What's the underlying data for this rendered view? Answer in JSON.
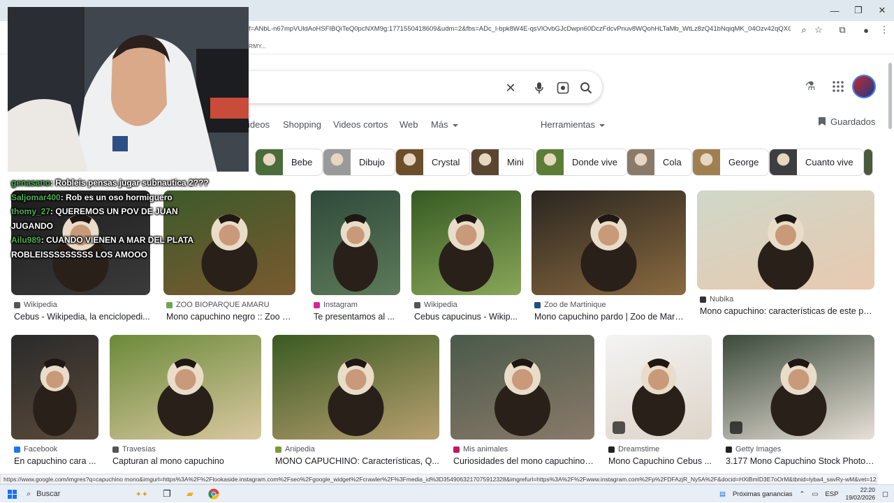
{
  "browser": {
    "url": "f=ANbL-n67mpVUldAoHSFIBQiTeQ0pcNXM9g:1771550418609&udm=2&fbs=ADc_l-bpk8W4E-qsVlOvbGJcDwpn60DczFdcvPnuv8WQohHLTaMb_WtLz8zQ41bNqiqMK_04Ozv42qQXGXRTV...",
    "bookmark_label": "RMY...",
    "status_url": "https://www.google.com/imgres?q=capuchino mono&imgurl=https%3A%2F%2Flookaside.instagram.com%2Fseo%2Fgoogle_widget%2Fcrawler%2F%3Fmedia_id%3D3549063217075912328&imgrefurl=https%3A%2F%2Fwww.instagram.com%2Fp%2FDFAzjR_Ny5A%2F&docid=HXiBmID3E7oOrM&tbnid=lyba4_savRy-wM&vet=12ahUKEwil_djM8-aSAxWS..."
  },
  "tabs": [
    {
      "label": "ideos"
    },
    {
      "label": "Shopping"
    },
    {
      "label": "Videos cortos"
    },
    {
      "label": "Web"
    },
    {
      "label": "Más"
    }
  ],
  "tools_label": "Herramientas",
  "saved_label": "Guardados",
  "chips": [
    {
      "label": "Bebe",
      "color": "#4a6b3a"
    },
    {
      "label": "Dibujo",
      "color": "#9a9a9a"
    },
    {
      "label": "Crystal",
      "color": "#6b4e2a"
    },
    {
      "label": "Mini",
      "color": "#5a4630"
    },
    {
      "label": "Donde vive",
      "color": "#5b7d35"
    },
    {
      "label": "Cola",
      "color": "#8a7a6a"
    },
    {
      "label": "George",
      "color": "#a08050"
    },
    {
      "label": "Cuanto vive",
      "color": "#3e3e3e"
    }
  ],
  "chat": [
    {
      "user": "genasano",
      "msg": ": Robleis pensas jugar subnautica 2???"
    },
    {
      "user": "Saljomar400",
      "msg": ": Rob es un oso hormiguero"
    },
    {
      "user": "thomy_27",
      "msg": ": QUEREMOS UN POV DE JUAN JUGANDO"
    },
    {
      "user": "Ailu989",
      "msg": ": CUANDO VIENEN A MAR DEL PLATA ROBLEISSSSSSSSS LOS AMOOO"
    }
  ],
  "row1": [
    {
      "source": "Wikipedia",
      "title": "Cebus - Wikipedia, la enciclopedi...",
      "fav": "#555555",
      "c1": "#1c1c1c",
      "c2": "#3b3b3b"
    },
    {
      "source": "ZOO BIOPARQUE AMARU",
      "title": "Mono capuchino negro :: Zoo Bio...",
      "fav": "#6aa84f",
      "c1": "#3d5a2a",
      "c2": "#7a5a30"
    },
    {
      "source": "Instagram",
      "title": "Te presentamos al ...",
      "fav": "#d6249f",
      "c1": "#2f4a3a",
      "c2": "#5e7a5a"
    },
    {
      "source": "Wikipedia",
      "title": "Cebus capucinus - Wikip...",
      "fav": "#555555",
      "c1": "#355a22",
      "c2": "#8aa65a"
    },
    {
      "source": "Zoo de Martinique",
      "title": "Mono capuchino pardo | Zoo de Marti...",
      "fav": "#1a4f8a",
      "c1": "#2a2620",
      "c2": "#8a6a40"
    },
    {
      "source": "Nubika",
      "title": "Mono capuchino: características de este pri...",
      "fav": "#333333",
      "c1": "#cfd8c8",
      "c2": "#e8c9b0"
    }
  ],
  "row2": [
    {
      "source": "Facebook",
      "title": "En capuchino cara ...",
      "fav": "#1877f2",
      "c1": "#2a2a2a",
      "c2": "#5a4a3a"
    },
    {
      "source": "Travesías",
      "title": "Capturan al mono capuchino",
      "fav": "#555555",
      "c1": "#6b8a3a",
      "c2": "#d9c8a0"
    },
    {
      "source": "Anipedia",
      "title": "MONO CAPUCHINO: Características, Q...",
      "fav": "#7a9a3a",
      "c1": "#3a5a22",
      "c2": "#b8a070"
    },
    {
      "source": "Mis animales",
      "title": "Curiosidades del mono capuchino ...",
      "fav": "#c2185b",
      "c1": "#4a5a4a",
      "c2": "#8a7a6a"
    },
    {
      "source": "Dreamstime",
      "title": "Mono Capuchino Cebus ...",
      "fav": "#222222",
      "c1": "#f4f4f4",
      "c2": "#ddd4c8"
    },
    {
      "source": "Getty Images",
      "title": "3.177 Mono Capuchino Stock Photos...",
      "fav": "#222222",
      "c1": "#3a4a3a",
      "c2": "#e8e0d8"
    }
  ],
  "taskbar": {
    "search_placeholder": "Buscar",
    "weather": "Próximas ganancias",
    "lang": "ESP",
    "time": "22:20",
    "date": "19/02/2026"
  }
}
